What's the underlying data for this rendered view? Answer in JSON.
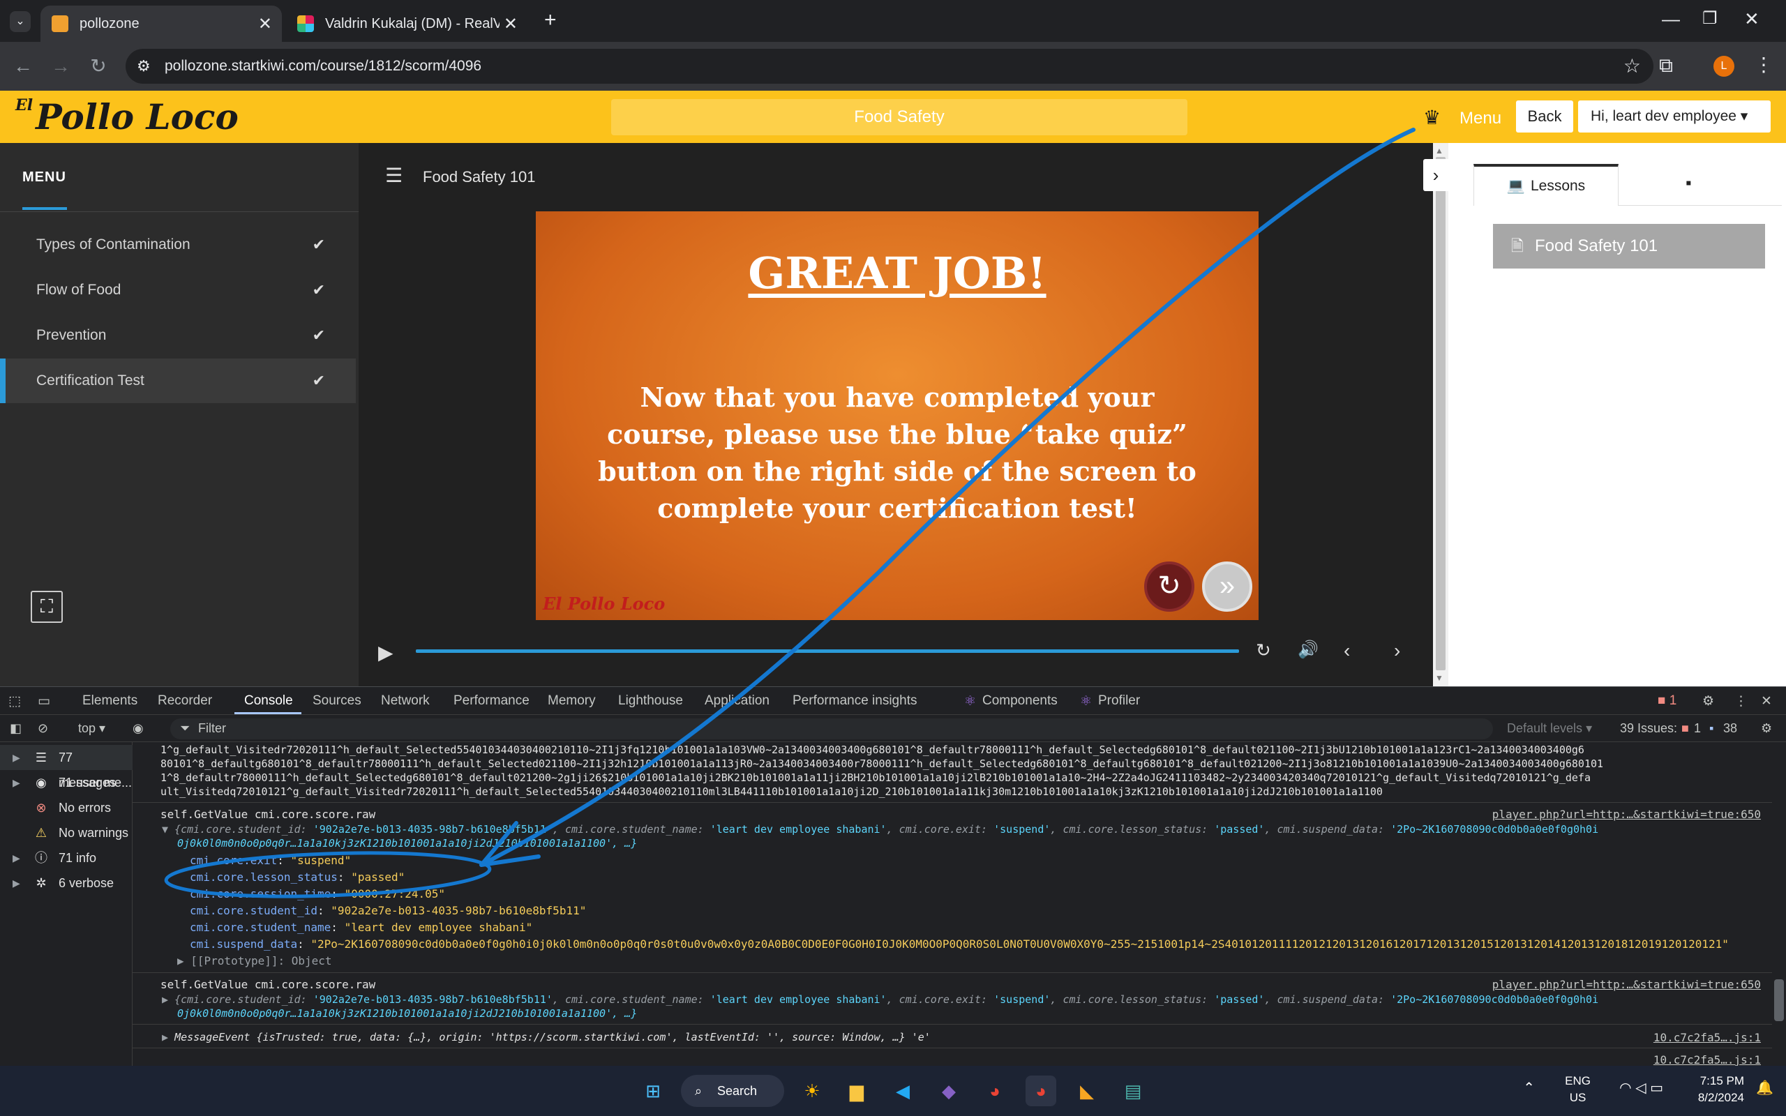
{
  "browser": {
    "tabs": [
      {
        "title": "pollozone",
        "active": true
      },
      {
        "title": "Valdrin Kukalaj (DM) - RealVisua",
        "active": false
      }
    ],
    "url": "pollozone.startkiwi.com/course/1812/scorm/4096",
    "profile_initial": "L"
  },
  "site": {
    "logo_prefix": "El",
    "logo_text": "Pollo Loco",
    "course_title": "Food Safety",
    "menu_label": "Menu",
    "back_label": "Back",
    "user_label": "Hi, leart dev employee ▾",
    "brand_color": "#fcc21b"
  },
  "menu": {
    "title": "MENU",
    "items": [
      {
        "label": "Types of Contamination",
        "check": "✔"
      },
      {
        "label": "Flow of Food",
        "check": "✔"
      },
      {
        "label": "Prevention",
        "check": "✔"
      },
      {
        "label": "Certification Test",
        "check": "✔",
        "selected": true
      }
    ]
  },
  "player": {
    "title": "Food Safety 101",
    "slide_heading": "GREAT JOB!",
    "slide_body": "Now that you have completed your course, please use the blue “take quiz” button on the right side of the screen to complete your certification test!",
    "slide_logo": "El Pollo Loco",
    "progress": 1.0
  },
  "right_panel": {
    "tab_lessons": "Lessons",
    "lesson_item": "Food Safety 101"
  },
  "devtools": {
    "tabs": [
      "Elements",
      "Recorder",
      "Console",
      "Sources",
      "Network",
      "Performance",
      "Memory",
      "Lighthouse",
      "Application",
      "Performance insights",
      "Components",
      "Profiler"
    ],
    "active_tab": "Console",
    "context": "top",
    "filter_placeholder": "Filter",
    "levels": "Default levels",
    "issues_label": "39 Issues:",
    "issues_errors": "1",
    "issues_info": "38",
    "error_badge": "1",
    "sidebar": [
      {
        "label": "77 messages",
        "icon": "list-icon"
      },
      {
        "label": "71 user me...",
        "icon": "user-icon"
      },
      {
        "label": "No errors",
        "icon": "error-icon"
      },
      {
        "label": "No warnings",
        "icon": "warning-icon"
      },
      {
        "label": "71 info",
        "icon": "info-icon"
      },
      {
        "label": "6 verbose",
        "icon": "bug-icon"
      }
    ],
    "log_top": [
      "1^g_default_Visitedr72020111^h_default_Selected554010344030400210110~2I1j3fq1210b101001a1a103VW0~2a1340034003400g680101^8_defaultr78000111^h_default_Selectedg680101^8_default021100~2I1j3bU1210b101001a1a123rC1~2a1340034003400g6",
      "80101^8_defaultg680101^8_defaultr78000111^h_default_Selected021100~2I1j32h1210b101001a1a113jR0~2a1340034003400r78000111^h_default_Selectedg680101^8_defaultg680101^8_default021200~2I1j3o81210b101001a1a1039U0~2a1340034003400g680101",
      "1^8_defaultr78000111^h_default_Selectedg680101^8_default021200~2g1ji26$210b101001a1a10ji2BK210b101001a1a11ji2BH210b101001a1a10ji2lB210b101001a1a10~2H4~2Z2a4oJG2411103482~2y234003420340q72010121^g_default_Visitedq72010121^g_defa",
      "ult_Visitedq72010121^g_default_Visitedr72020111^h_default_Selected554010344030400210110ml3LB441110b101001a1a10ji2D_210b101001a1a11kj30m1210b101001a1a10kj3zK1210b101001a1a10ji2dJ210b101001a1a1100"
    ],
    "call1": "self.GetValue cmi.core.score.raw",
    "src1": "player.php?url=http:…&startkiwi=true:650",
    "obj1_line1_pre": "{cmi.core.student_id: ",
    "obj1_student_id": "'902a2e7e-b013-4035-98b7-b610e8bf5b11'",
    "obj1_mid1": ", cmi.core.student_name: ",
    "obj1_student_name": "'leart dev employee shabani'",
    "obj1_mid2": ", cmi.core.exit: ",
    "obj1_exit": "'suspend'",
    "obj1_mid3": ", cmi.core.lesson_status: ",
    "obj1_status": "'passed'",
    "obj1_mid4": ", cmi.suspend_data: ",
    "obj1_suspend": "'2Po~2K160708090c0d0b0a0e0f0g0h0i",
    "obj1_line2": "0j0k0l0m0n0o0p0q0r…1a1a10kj3zK1210b101001a1a10ji2dJ210b101001a1a1100', …}",
    "props": [
      {
        "k": "cmi.core.exit",
        "v": "\"suspend\""
      },
      {
        "k": "cmi.core.lesson_status",
        "v": "\"passed\""
      },
      {
        "k": "cmi.core.session_time",
        "v": "\"0000:27:24.05\""
      },
      {
        "k": "cmi.core.student_id",
        "v": "\"902a2e7e-b013-4035-98b7-b610e8bf5b11\""
      },
      {
        "k": "cmi.core.student_name",
        "v": "\"leart dev employee shabani\""
      },
      {
        "k": "cmi.suspend_data",
        "v": "\"2Po~2K160708090c0d0b0a0e0f0g0h0i0j0k0l0m0n0o0p0q0r0s0t0u0v0w0x0y0z0A0B0C0D0E0F0G0H0I0J0K0M0O0P0Q0R0S0L0N0T0U0V0W0X0Y0~255~2151001p14~2S40101201111201212013120161201712013120151201312014120131201812019120120121\""
      }
    ],
    "prototype": "[[Prototype]]: Object",
    "call2": "self.GetValue cmi.core.score.raw",
    "src2": "player.php?url=http:…&startkiwi=true:650",
    "msg_event": "MessageEvent {isTrusted: true, data: {…}, origin: 'https://scorm.startkiwi.com', lastEventId: '', source: Window, …} 'e'",
    "src3": "10.c7c2fa5….js:1",
    "src4": "10.c7c2fa5….js:1"
  },
  "taskbar": {
    "search": "Search",
    "lang1": "ENG",
    "lang2": "US",
    "time": "7:15 PM",
    "date": "8/2/2024"
  }
}
